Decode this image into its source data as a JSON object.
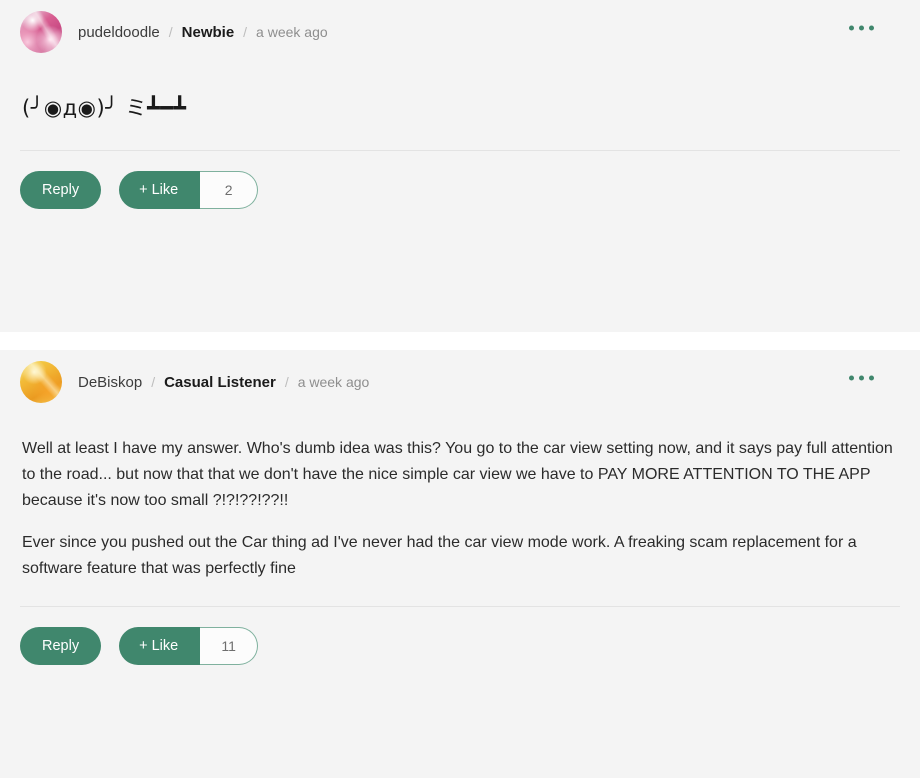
{
  "theme": {
    "accent_green": "#40876d",
    "post_background": "#f4f4f4",
    "page_background": "#ffffff",
    "divider": "#e3e3e3"
  },
  "posts": [
    {
      "author": "pudeldoodle",
      "role": "Newbie",
      "timestamp": "a week ago",
      "separator": "/",
      "avatar_name": "avatar-pudeldoodle",
      "more_icon": "ellipsis-icon",
      "body_kaomoji": "(╯◉д◉)╯ ミ┻━┻",
      "reply_label": "Reply",
      "like_label": "+ Like",
      "like_count": "2"
    },
    {
      "author": "DeBiskop",
      "role": "Casual Listener",
      "timestamp": "a week ago",
      "separator": "/",
      "avatar_name": "avatar-debiskop",
      "more_icon": "ellipsis-icon",
      "paragraph_1": "Well at least I have my answer. Who's dumb idea was this? You go to the car view setting now, and it says pay full attention to the road... but now that that we don't have the nice simple car view we have to PAY MORE ATTENTION TO THE APP because it's now too small ?!?!??!??!!",
      "paragraph_2": "Ever since you pushed out the Car thing ad I've never had the car view mode work. A freaking scam replacement for a software feature that was perfectly fine",
      "reply_label": "Reply",
      "like_label": "+ Like",
      "like_count": "11"
    }
  ]
}
